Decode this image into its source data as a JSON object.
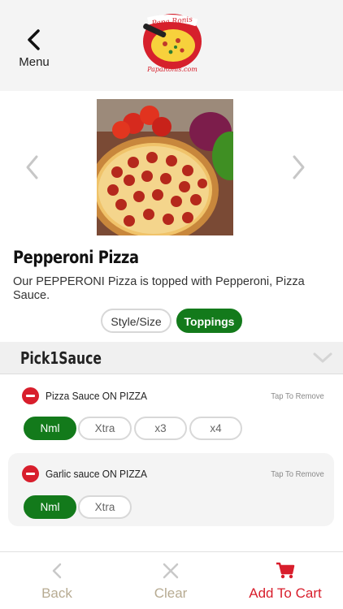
{
  "header": {
    "menu_label": "Menu"
  },
  "logo": {
    "text_top": "Papa Ronis",
    "text_bottom": "PapaRonis.com"
  },
  "product": {
    "title": "Pepperoni Pizza",
    "description": "Our PEPPERONI Pizza is topped with Pepperoni, Pizza Sauce."
  },
  "tabs": {
    "style_size": "Style/Size",
    "toppings": "Toppings",
    "active": "toppings"
  },
  "section": {
    "title": "Pick1Sauce",
    "items": [
      {
        "name": "Pizza Sauce ON PIZZA",
        "action": "Tap To Remove",
        "options": [
          "Nml",
          "Xtra",
          "x3",
          "x4"
        ],
        "selected": "Nml"
      },
      {
        "name": "Garlic sauce ON PIZZA",
        "action": "Tap To Remove",
        "options": [
          "Nml",
          "Xtra"
        ],
        "selected": "Nml"
      }
    ]
  },
  "bottom": {
    "back": "Back",
    "clear": "Clear",
    "add_to_cart": "Add To Cart"
  },
  "colors": {
    "accent_green": "#137a1b",
    "accent_red": "#d81e2c",
    "muted": "#b7ab92"
  },
  "icons": [
    "chevron-left-icon",
    "chevron-right-icon",
    "chevron-down-icon",
    "minus-circle-icon",
    "close-icon",
    "cart-icon"
  ]
}
